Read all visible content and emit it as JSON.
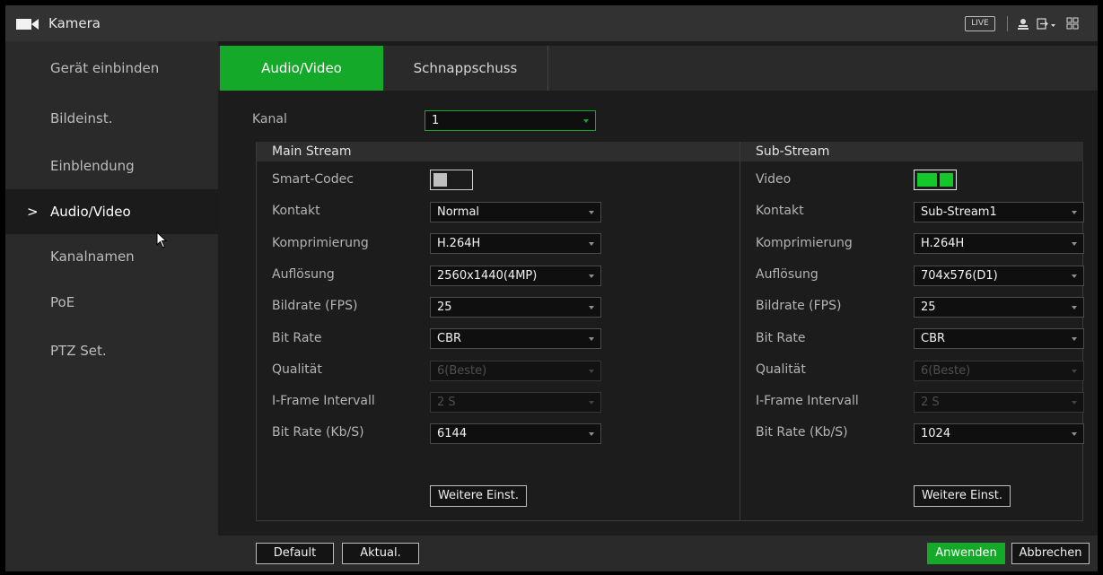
{
  "titlebar": {
    "title": "Kamera",
    "live_label": "LIVE",
    "icons": [
      "camera-icon",
      "user-icon",
      "logout-icon",
      "grid-icon"
    ]
  },
  "sidebar": {
    "items": [
      {
        "label": "Gerät einbinden"
      },
      {
        "label": "Bildeinst."
      },
      {
        "label": "Einblendung"
      },
      {
        "label": "Audio/Video",
        "active": true
      },
      {
        "label": "Kanalnamen"
      },
      {
        "label": "PoE"
      },
      {
        "label": "PTZ Set."
      }
    ],
    "chevron": ">"
  },
  "tabs": [
    "Audio/Video",
    "Schnappschuss"
  ],
  "channel": {
    "label": "Kanal",
    "value": "1"
  },
  "main_stream": {
    "title": "Main Stream",
    "smart_codec_label": "Smart-Codec",
    "smart_codec_on": false,
    "contact_label": "Kontakt",
    "contact": "Normal",
    "compression_label": "Komprimierung",
    "compression": "H.264H",
    "resolution_label": "Auflösung",
    "resolution": "2560x1440(4MP)",
    "fps_label": "Bildrate (FPS)",
    "fps": "25",
    "bitrate_type_label": "Bit Rate",
    "bitrate_type": "CBR",
    "quality_label": "Qualität",
    "quality": "6(Beste)",
    "iframe_label": "I-Frame Intervall",
    "iframe": "2 S",
    "bitrate_label": "Bit Rate (Kb/S)",
    "bitrate": "6144",
    "more_button": "Weitere Einst."
  },
  "sub_stream": {
    "title": "Sub-Stream",
    "video_label": "Video",
    "video_on": true,
    "contact_label": "Kontakt",
    "contact": "Sub-Stream1",
    "compression_label": "Komprimierung",
    "compression": "H.264H",
    "resolution_label": "Auflösung",
    "resolution": "704x576(D1)",
    "fps_label": "Bildrate (FPS)",
    "fps": "25",
    "bitrate_type_label": "Bit Rate",
    "bitrate_type": "CBR",
    "quality_label": "Qualität",
    "quality": "6(Beste)",
    "iframe_label": "I-Frame Intervall",
    "iframe": "2 S",
    "bitrate_label": "Bit Rate (Kb/S)",
    "bitrate": "1024",
    "more_button": "Weitere Einst."
  },
  "footer": {
    "default_label": "Default",
    "refresh_label": "Aktual.",
    "apply_label": "Anwenden",
    "cancel_label": "Abbrechen"
  },
  "colors": {
    "accent": "#14a929",
    "background": "#1b1b1b",
    "sidebar": "#2a2a2a"
  }
}
